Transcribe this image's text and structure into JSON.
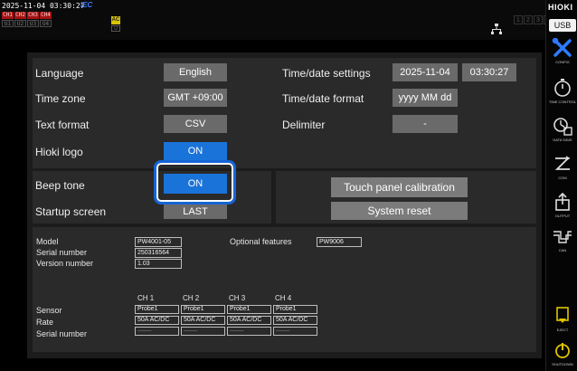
{
  "status": {
    "datetime": "2025-11-04 03:30:27",
    "standard": "IEC",
    "ch_top": [
      "CH1",
      "CH2",
      "CH3",
      "CH4"
    ],
    "ch_bottom": [
      "U1",
      "U2",
      "U3",
      "U4"
    ],
    "flag_top": "AC",
    "flag_bottom": "U",
    "net_nums": [
      "1",
      "2",
      "3",
      "4"
    ]
  },
  "sidebar": {
    "brand": "HIOKI",
    "usb": "USB",
    "buttons": [
      {
        "label": "CONFIG",
        "icon": "tools-icon"
      },
      {
        "label": "TIME CONTROL",
        "icon": "stopwatch-icon"
      },
      {
        "label": "DATA SAVE",
        "icon": "data-save-icon"
      },
      {
        "label": "COM",
        "icon": "com-icon"
      },
      {
        "label": "OUTPUT",
        "icon": "output-icon"
      },
      {
        "label": "CAN",
        "icon": "can-icon"
      },
      {
        "label": "EJECT",
        "icon": "eject-icon"
      },
      {
        "label": "SHUTDOWN",
        "icon": "shutdown-icon"
      }
    ]
  },
  "settings": {
    "language_label": "Language",
    "language_value": "English",
    "timezone_label": "Time zone",
    "timezone_value": "GMT +09:00",
    "textformat_label": "Text format",
    "textformat_value": "CSV",
    "logo_label": "Hioki logo",
    "logo_value": "ON",
    "timedate_label": "Time/date settings",
    "date_value": "2025-11-04",
    "time_value": "03:30:27",
    "timeformat_label": "Time/date format",
    "timeformat_value": "yyyy MM dd",
    "delimiter_label": "Delimiter",
    "delimiter_value": "-",
    "beep_label": "Beep tone",
    "beep_value": "ON",
    "startup_label": "Startup screen",
    "startup_value": "LAST",
    "touch_calib": "Touch panel calibration",
    "system_reset": "System reset"
  },
  "info": {
    "model_label": "Model",
    "model_value": "PW4001-05",
    "serial_label": "Serial number",
    "serial_value": "250316564",
    "version_label": "Version number",
    "version_value": "1.03",
    "optional_label": "Optional features",
    "optional_value": "PW9006",
    "channels": [
      "CH 1",
      "CH 2",
      "CH 3",
      "CH 4"
    ],
    "sensor_label": "Sensor",
    "rate_label": "Rate",
    "sensor_serial_label": "Serial number",
    "sensors": [
      "Probe1",
      "Probe1",
      "Probe1",
      "Probe1"
    ],
    "rates": [
      "50A AC/DC",
      "50A AC/DC",
      "50A AC/DC",
      "50A AC/DC"
    ],
    "serials": [
      "----------",
      "----------",
      "----------",
      "----------"
    ]
  },
  "colors": {
    "on_button": "#1a73d9",
    "focus": "#1565d6",
    "brand_red": "#a31212"
  }
}
